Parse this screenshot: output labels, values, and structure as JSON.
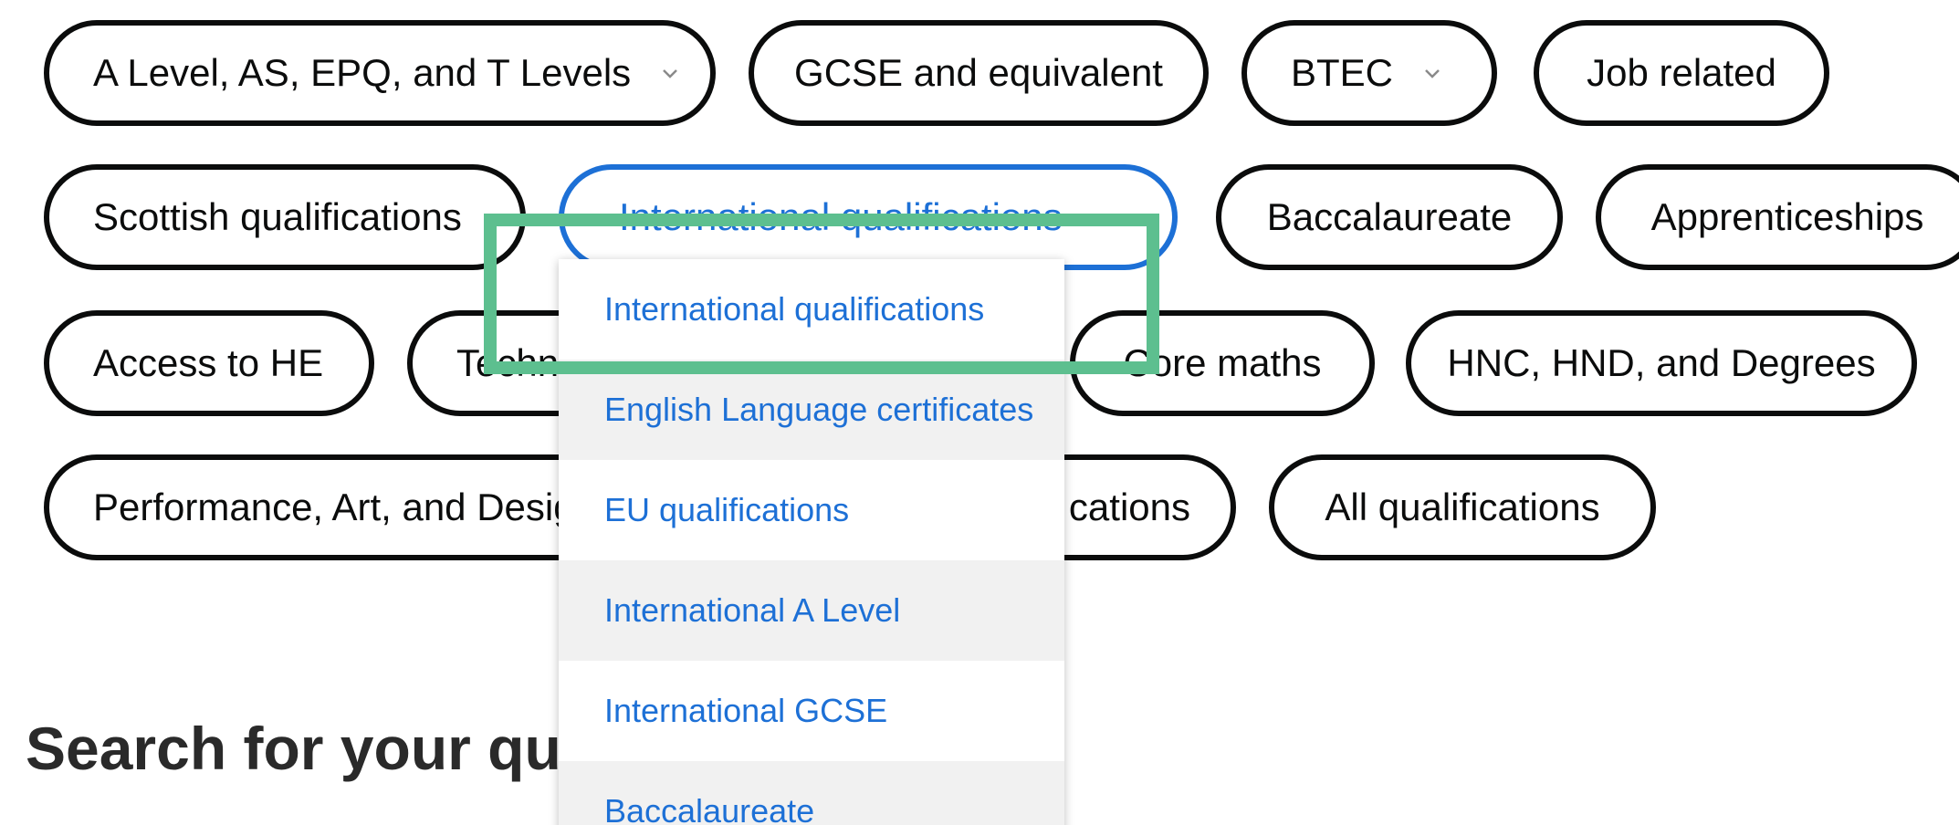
{
  "filters": {
    "row1": [
      {
        "label": "A Level, AS, EPQ, and T Levels",
        "has_chevron": true
      },
      {
        "label": "GCSE and equivalent",
        "has_chevron": false
      },
      {
        "label": "BTEC",
        "has_chevron": true
      },
      {
        "label": "Job related",
        "has_chevron": false
      }
    ],
    "row2": [
      {
        "label": "Scottish qualifications",
        "has_chevron": false
      },
      {
        "label": "International qualifications",
        "has_chevron": true,
        "active": true
      },
      {
        "label": "Baccalaureate",
        "has_chevron": false
      },
      {
        "label": "Apprenticeships",
        "has_chevron": false
      }
    ],
    "row3": [
      {
        "label": "Access to HE",
        "has_chevron": false
      },
      {
        "label": "Techn",
        "has_chevron": false
      },
      {
        "label": "Core maths",
        "has_chevron": false
      },
      {
        "label": "HNC, HND, and Degrees",
        "has_chevron": false
      }
    ],
    "row4": [
      {
        "label": "Performance, Art, and Desig",
        "has_chevron": false
      },
      {
        "label": "cations",
        "has_chevron": false
      },
      {
        "label": "All qualifications",
        "has_chevron": false
      }
    ]
  },
  "dropdown": {
    "items": [
      "International qualifications",
      "English Language certificates",
      "EU qualifications",
      "International A Level",
      "International GCSE",
      "Baccalaureate"
    ]
  },
  "heading": "Search for your qu",
  "colors": {
    "accent": "#1d70d6",
    "pill_border": "#0b0c0c",
    "highlight": "#5dbf8f",
    "dropdown_shaded": "#f1f1f1"
  },
  "icons": {
    "chevron": "chevron-down-icon"
  }
}
